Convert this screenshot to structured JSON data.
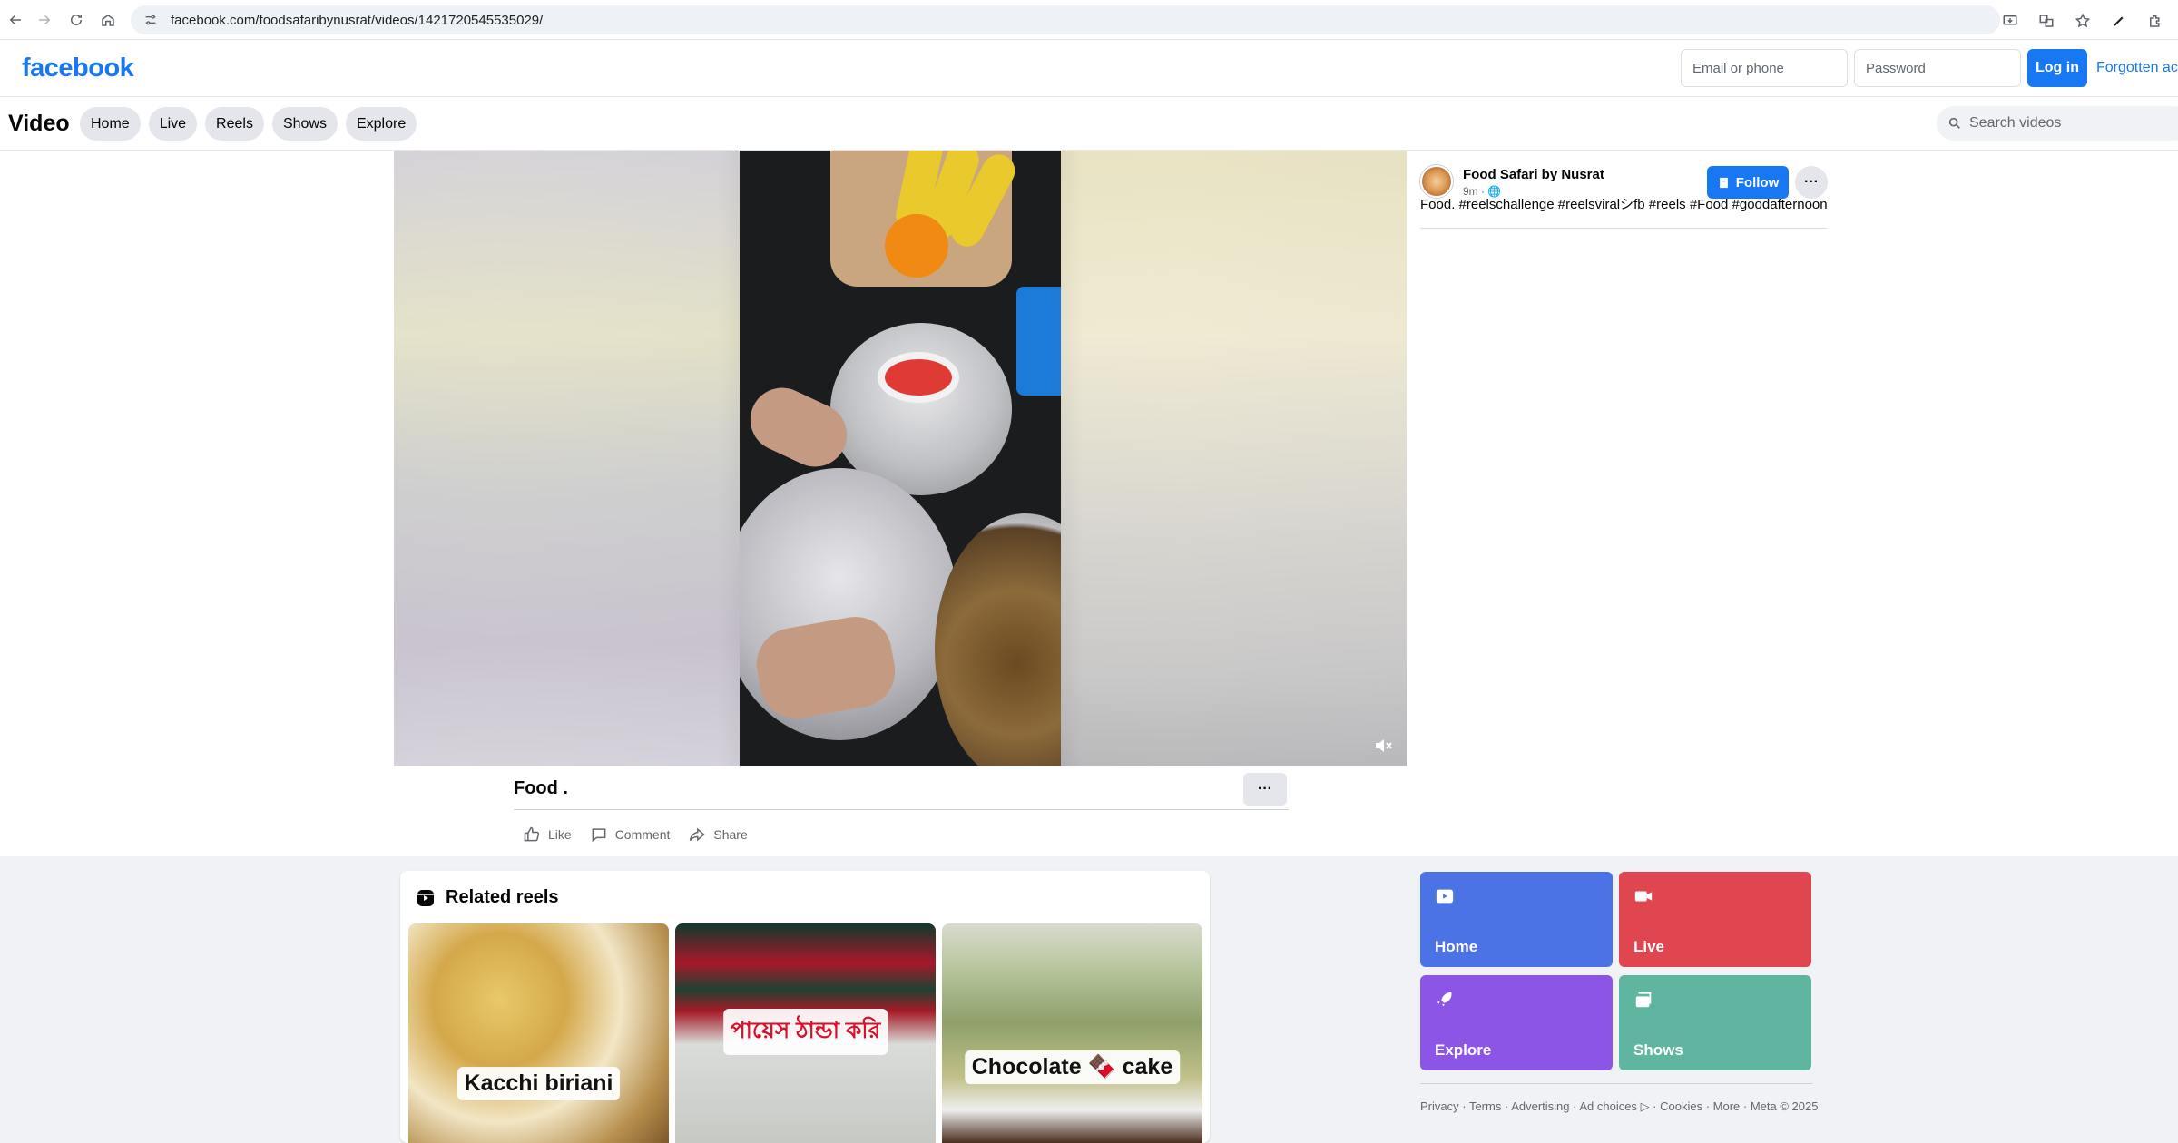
{
  "browser": {
    "url": "facebook.com/foodsafaribynusrat/videos/1421720545535029/"
  },
  "header": {
    "logo": "facebook",
    "email_placeholder": "Email or phone",
    "password_placeholder": "Password",
    "login_label": "Log in",
    "forgot_label": "Forgotten acc"
  },
  "video_nav": {
    "title": "Video",
    "tabs": [
      {
        "label": "Home"
      },
      {
        "label": "Live"
      },
      {
        "label": "Reels"
      },
      {
        "label": "Shows"
      },
      {
        "label": "Explore"
      }
    ],
    "search_placeholder": "Search videos"
  },
  "post": {
    "page_name": "Food Safari by Nusrat",
    "meta": "9m · 🌐",
    "follow_label": "Follow",
    "more_label": "···",
    "caption": "Food. #reelschallenge #reelsviralシfb #reels #Food #goodafternoon"
  },
  "video": {
    "name": "Food .",
    "more_label": "···",
    "actions": [
      {
        "label": "Like",
        "icon": "like-icon"
      },
      {
        "label": "Comment",
        "icon": "comment-icon"
      },
      {
        "label": "Share",
        "icon": "share-icon"
      }
    ]
  },
  "related": {
    "title": "Related reels",
    "reels": [
      {
        "label": "Kacchi biriani"
      },
      {
        "label": "পায়েস ঠান্ডা করি"
      },
      {
        "label": "Chocolate 🍫 cake"
      }
    ]
  },
  "shortcuts": [
    {
      "label": "Home",
      "icon": "play-icon",
      "color": "#4b73e6"
    },
    {
      "label": "Live",
      "icon": "live-camera-icon",
      "color": "#e04650"
    },
    {
      "label": "Explore",
      "icon": "rocket-icon",
      "color": "#8d55e6"
    },
    {
      "label": "Shows",
      "icon": "shows-icon",
      "color": "#5fb59f"
    }
  ],
  "footer": {
    "links": [
      "Privacy",
      "Terms",
      "Advertising",
      "Ad choices",
      "Cookies",
      "More"
    ],
    "copyright": "Meta © 2025"
  },
  "colors": {
    "brand_blue": "#1877f2",
    "page_grey": "#f0f2f5"
  }
}
